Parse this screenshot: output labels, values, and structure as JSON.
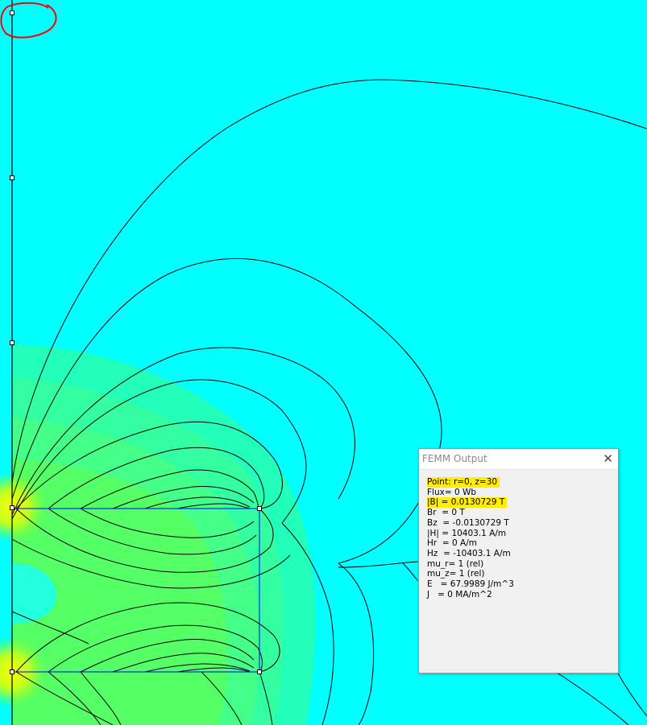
{
  "window": {
    "title": "FEMM Output",
    "close_label": "✕"
  },
  "output_lines": [
    "Point: r=0, z=30",
    "Flux= 0 Wb",
    "|B| = 0.0130729 T",
    "Br  = 0 T",
    "Bz  = -0.0130729 T",
    "|H| = 10403.1 A/m",
    "Hr  = 0 A/m",
    "Hz  = -10403.1 A/m",
    "mu_r= 1 (rel)",
    "mu_z= 1 (rel)",
    "E   = 67.9989 J/m^3",
    "J   = 0 MA/m^2"
  ],
  "highlighted_lines": [
    0,
    2
  ],
  "colors": {
    "background": "#00ffff",
    "highlight": "#ffee00",
    "annotation": "#ff0000",
    "boundary": "#0000ff"
  }
}
